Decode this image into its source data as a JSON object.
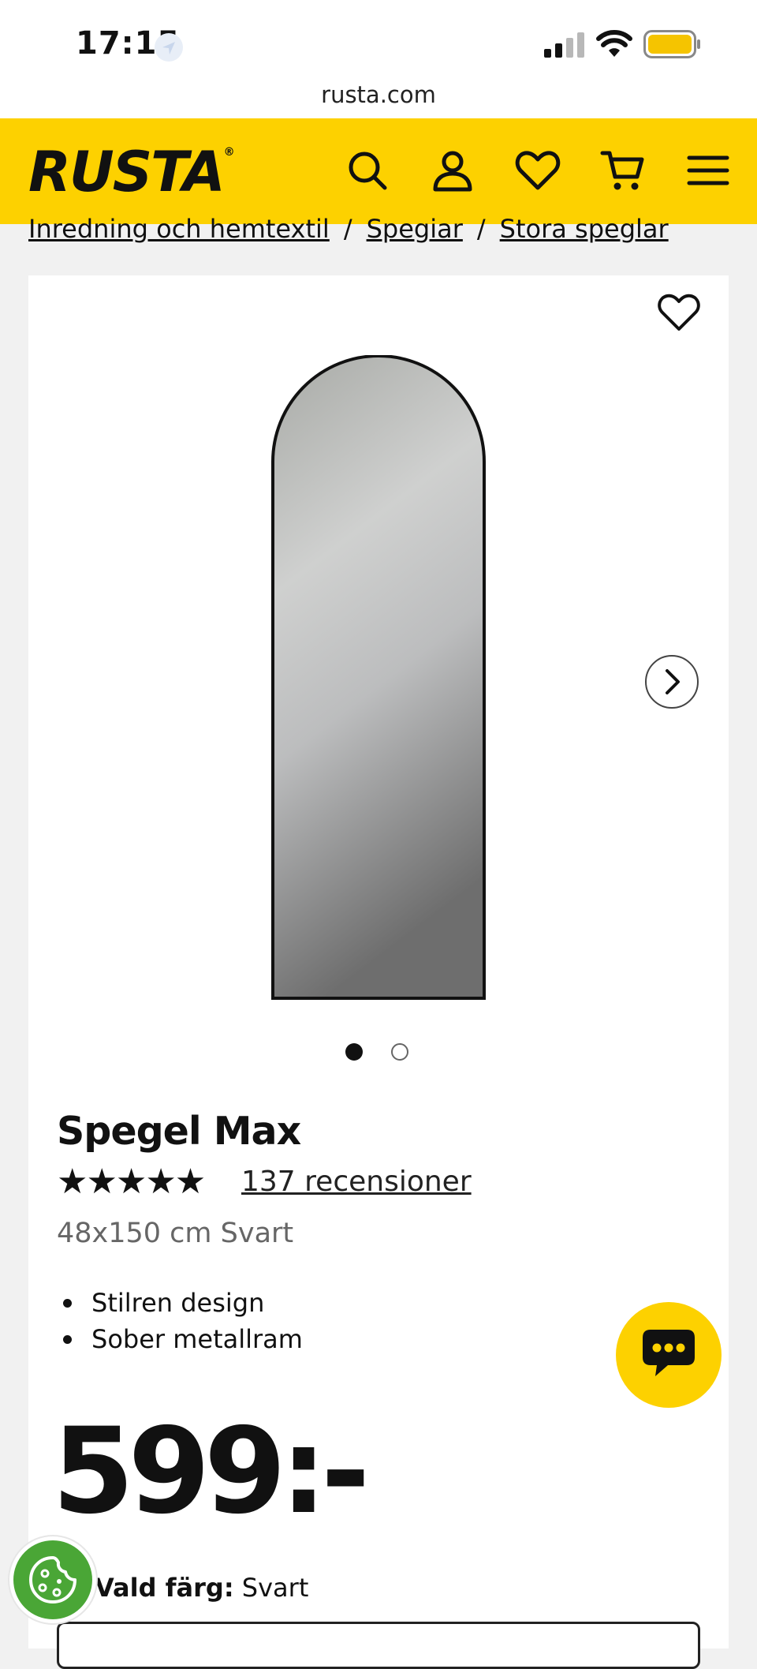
{
  "status_bar": {
    "time": "17:15",
    "icons": [
      "location-icon",
      "signal-icon",
      "wifi-icon",
      "battery-icon"
    ],
    "battery_color": "#f5c400"
  },
  "browser": {
    "url": "rusta.com"
  },
  "header": {
    "brand": "RUSTA",
    "brand_mark": "®",
    "background": "#fdd100",
    "icons": [
      "search-icon",
      "account-icon",
      "wishlist-icon",
      "cart-icon",
      "menu-icon"
    ]
  },
  "breadcrumb": {
    "items": [
      "Inredning och hemtextil",
      "Spegiar",
      "Stora speglar"
    ],
    "separator": "/"
  },
  "product": {
    "image_alt": "Spegel Max",
    "title": "Spegel Max",
    "rating_stars": "★★★★★",
    "rating": 5,
    "reviews": "137 recensioner",
    "variant": "48x150 cm Svart",
    "bullets": [
      "Stilren design",
      "Sober metallram"
    ],
    "price": "599:-",
    "color_label": "Vald färg:",
    "color_value": "Svart",
    "carousel": {
      "current": 1,
      "total": 2
    }
  },
  "floating": {
    "chat_icon": "chat-icon",
    "cookie_icon": "cookie-icon",
    "cookie_color": "#4aa636"
  }
}
